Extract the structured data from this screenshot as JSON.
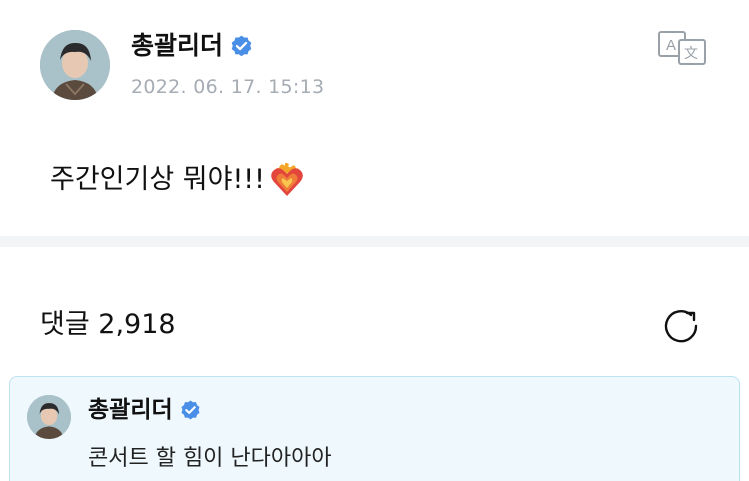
{
  "post": {
    "author": "총괄리더",
    "timestamp": "2022. 06. 17. 15:13",
    "body": "주간인기상 뭐야!!!"
  },
  "comments": {
    "count_label": "댓글 2,918",
    "items": [
      {
        "author": "총괄리더",
        "text": "콘서트 할 힘이 난다아아아"
      }
    ]
  },
  "icons": {
    "verified": "verified-badge-icon",
    "translate": "translate-icon",
    "refresh": "refresh-icon",
    "heart": "heart-on-fire-icon"
  },
  "colors": {
    "verified": "#4a8fe7",
    "timestamp": "#a6acb3",
    "comment_highlight_bg": "#eef8fd",
    "comment_highlight_border": "#bfe2f1",
    "divider": "#f3f4f6"
  }
}
